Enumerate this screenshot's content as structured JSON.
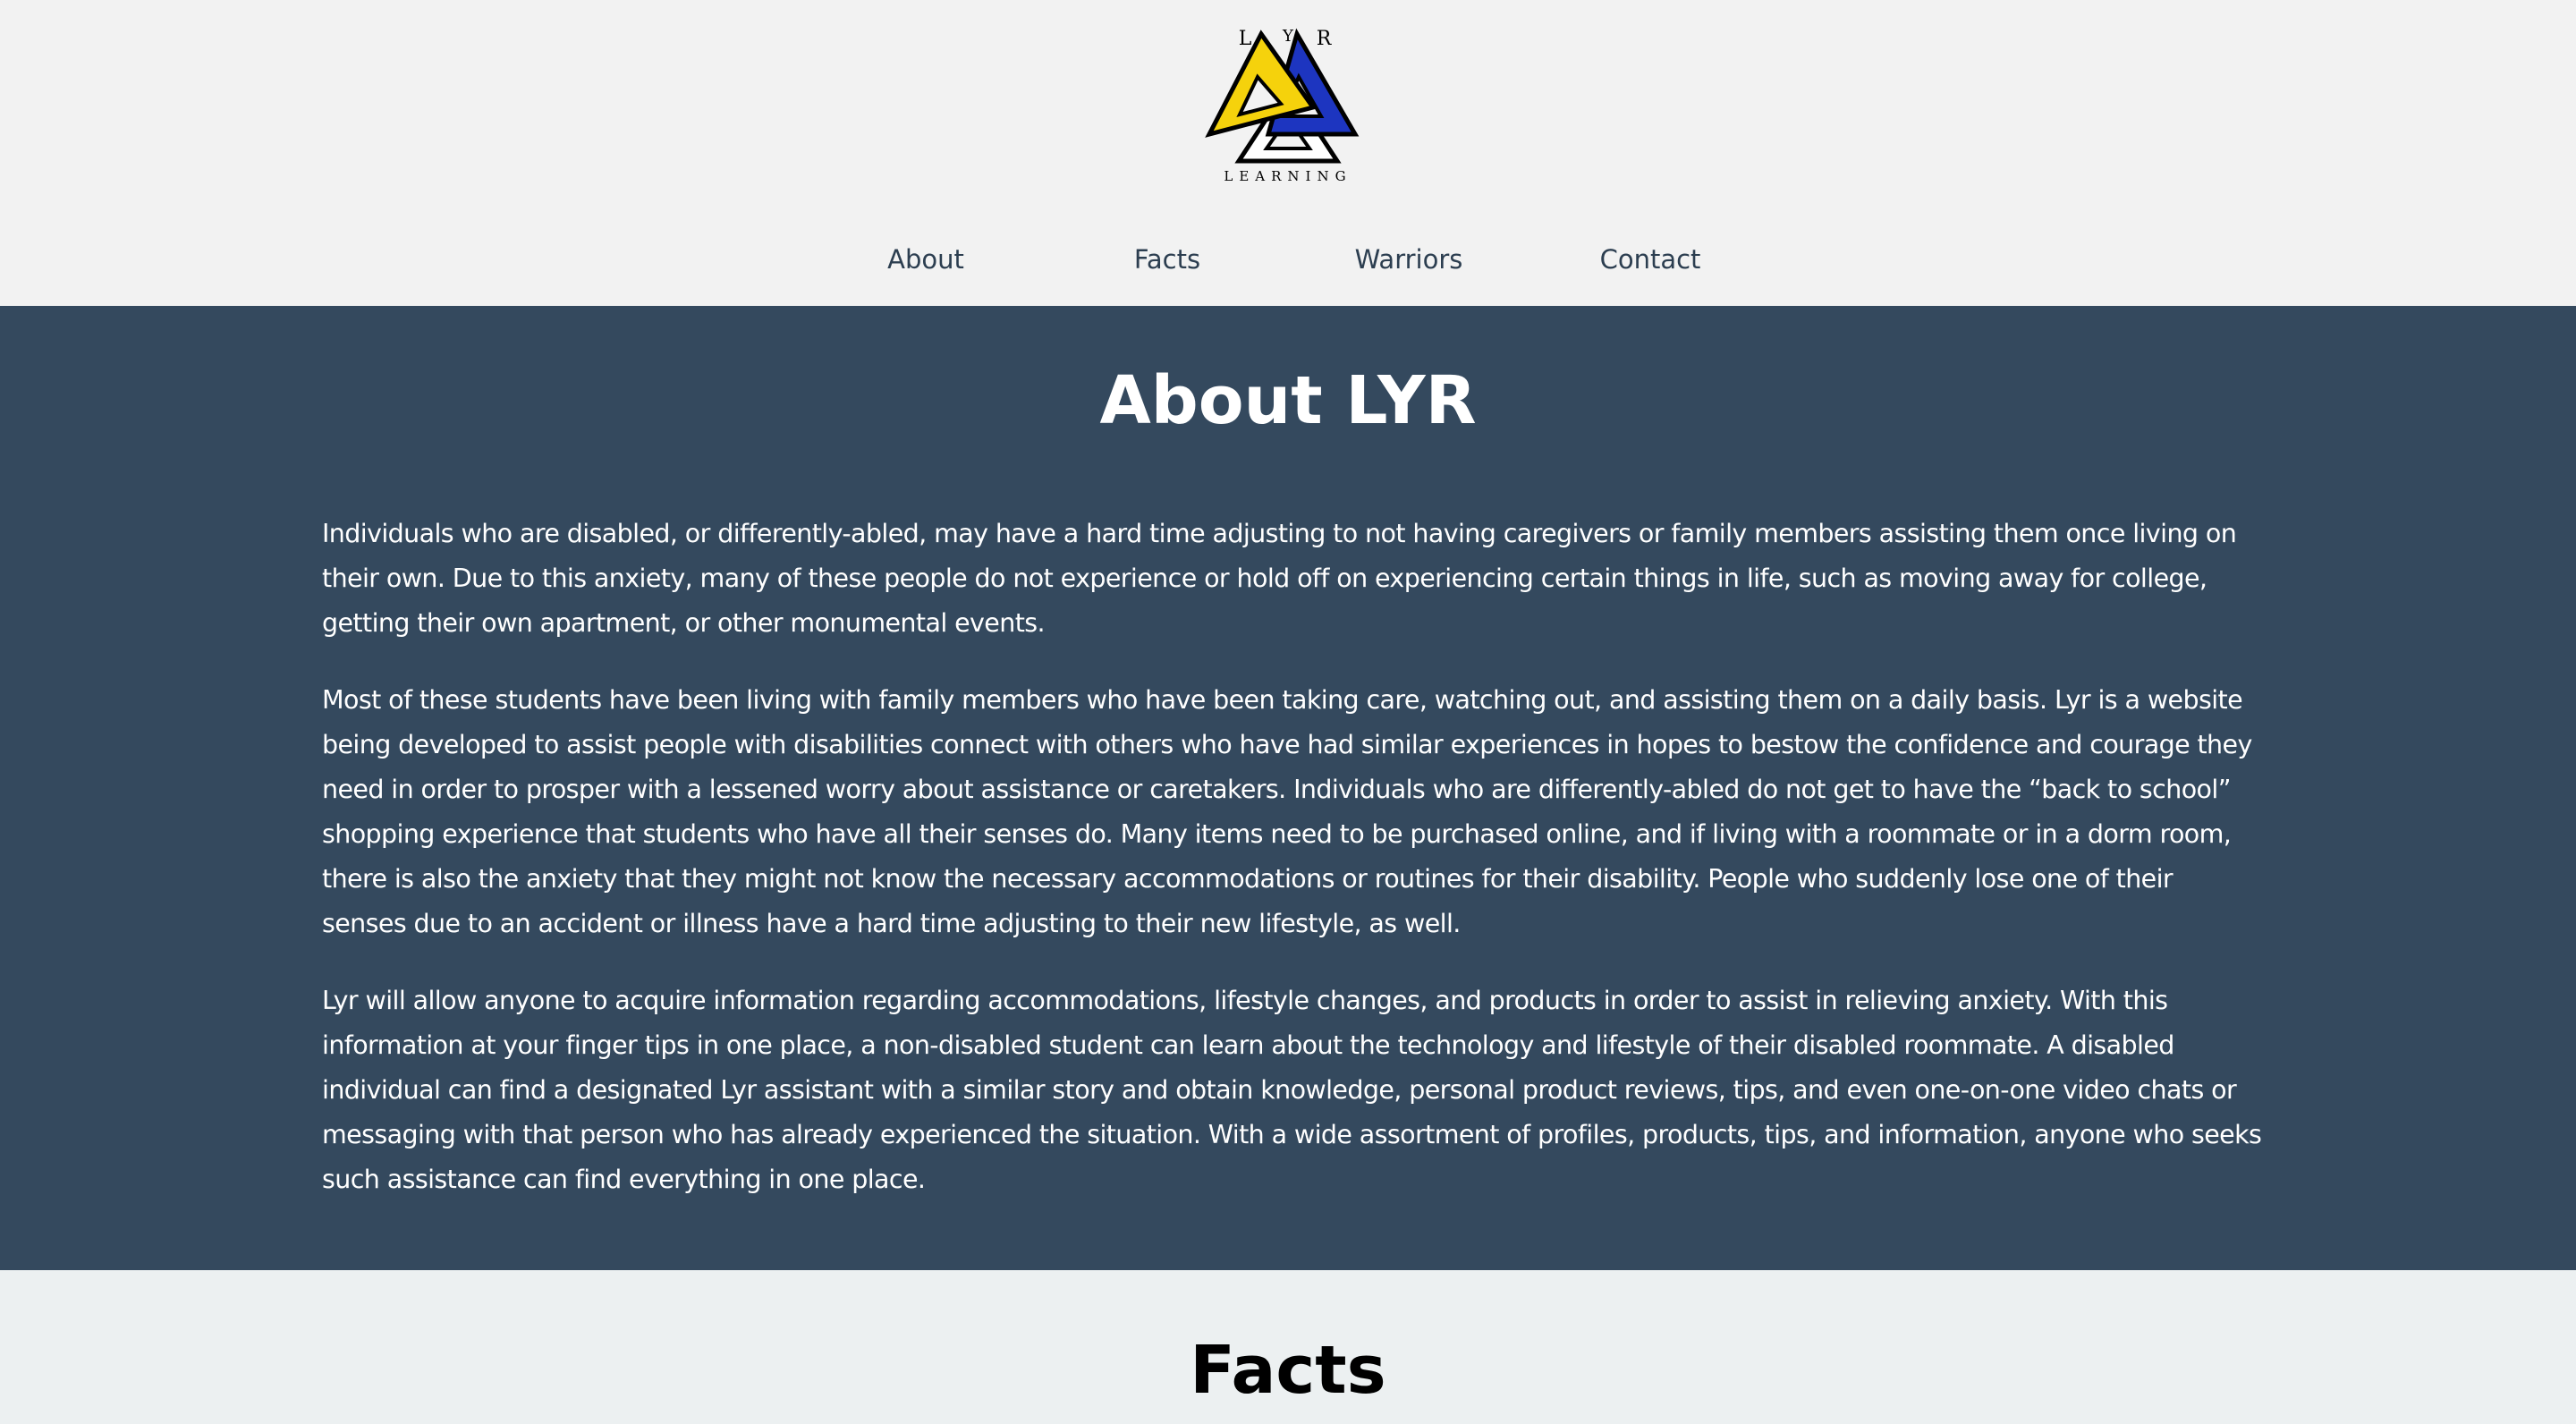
{
  "header": {
    "logo": {
      "icon": "lyr-triangles-logo",
      "letters": [
        "L",
        "Y",
        "R"
      ],
      "subtitle": "LEARNING",
      "colors": {
        "yellow": "#f5d20c",
        "blue": "#1d35c0",
        "white": "#ffffff",
        "outline": "#000000"
      }
    },
    "nav": [
      {
        "label": "About"
      },
      {
        "label": "Facts"
      },
      {
        "label": "Warriors"
      },
      {
        "label": "Contact"
      }
    ]
  },
  "about": {
    "title": "About LYR",
    "paragraphs": [
      "Individuals who are disabled, or differently-abled, may have a hard time adjusting to not having caregivers or family members assisting them once living on their own. Due to this anxiety, many of these people do not experience or hold off on experiencing certain things in life, such as moving away for college, getting their own apartment, or other monumental events.",
      "Most of these students have been living with family members who have been taking care, watching out, and assisting them on a daily basis. Lyr is a website being developed to assist people with disabilities connect with others who have had similar experiences in hopes to bestow the confidence and courage they need in order to prosper with a lessened worry about assistance or caretakers. Individuals who are differently-abled do not get to have the “back to school” shopping experience that students who have all their senses do. Many items need to be purchased online, and if living with a roommate or in a dorm room, there is also the anxiety that they might not know the necessary accommodations or routines for their disability. People who suddenly lose one of their senses due to an accident or illness have a hard time adjusting to their new lifestyle, as well.",
      "Lyr will allow anyone to acquire information regarding accommodations, lifestyle changes, and products in order to assist in relieving anxiety. With this information at your finger tips in one place, a non-disabled student can learn about the technology and lifestyle of their disabled roommate. A disabled individual can find a designated Lyr assistant with a similar story and obtain knowledge, personal product reviews, tips, and even one-on-one video chats or messaging with that person who has already experienced the situation. With a wide assortment of profiles, products, tips, and information, anyone who seeks such assistance can find everything in one place."
    ]
  },
  "facts": {
    "title": "Facts"
  },
  "colors": {
    "header_bg": "#f2f2f2",
    "about_bg": "#34495e",
    "facts_bg": "#ecf0f1",
    "nav_text": "#2c3e50"
  }
}
